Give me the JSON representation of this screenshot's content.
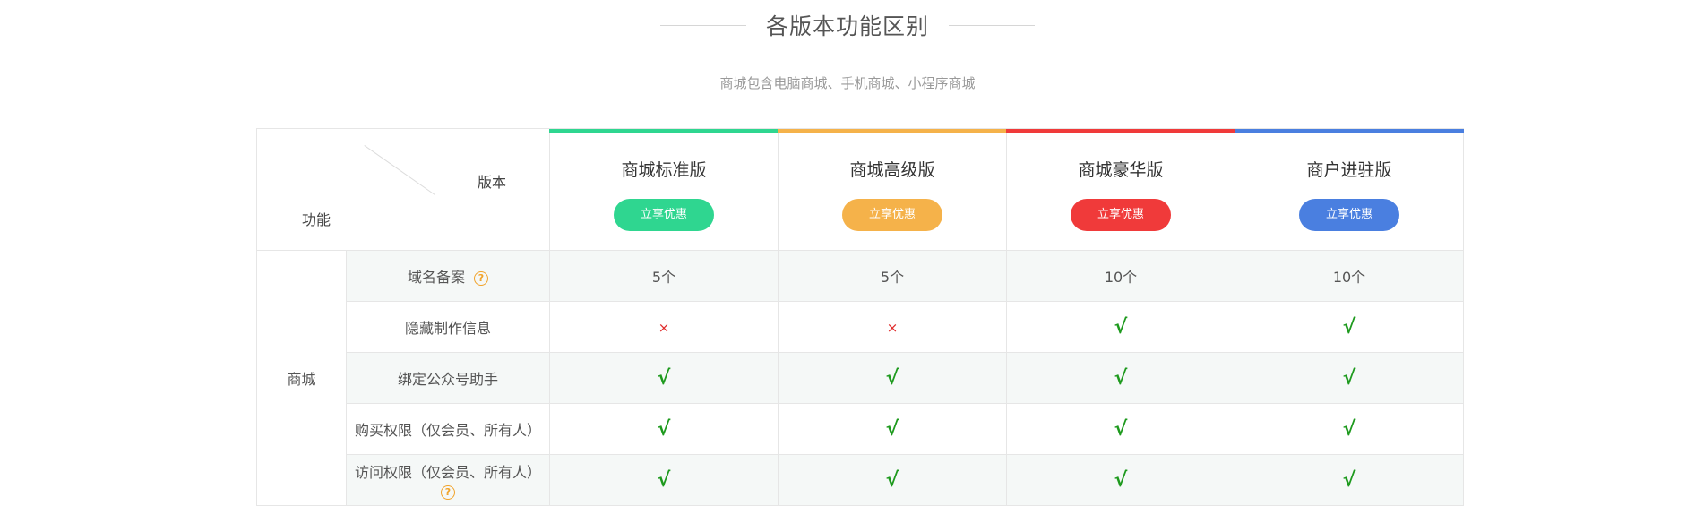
{
  "heading": {
    "title": "各版本功能区别",
    "subtitle": "商城包含电脑商城、手机商城、小程序商城"
  },
  "corner": {
    "version_label": "版本",
    "feature_label": "功能"
  },
  "colors": {
    "standard": "#2fd690",
    "advanced": "#f5b24a",
    "luxury": "#f03a3a",
    "merchant": "#4a7fe0"
  },
  "versions": [
    {
      "name": "商城标准版",
      "button": "立享优惠"
    },
    {
      "name": "商城高级版",
      "button": "立享优惠"
    },
    {
      "name": "商城豪华版",
      "button": "立享优惠"
    },
    {
      "name": "商户进驻版",
      "button": "立享优惠"
    }
  ],
  "category": "商城",
  "rows": [
    {
      "feature": "域名备案",
      "has_help": true,
      "values": [
        "5个",
        "5个",
        "10个",
        "10个"
      ]
    },
    {
      "feature": "隐藏制作信息",
      "has_help": false,
      "values": [
        "cross",
        "cross",
        "check",
        "check"
      ]
    },
    {
      "feature": "绑定公众号助手",
      "has_help": false,
      "values": [
        "check",
        "check",
        "check",
        "check"
      ]
    },
    {
      "feature": "购买权限（仅会员、所有人）",
      "has_help": false,
      "values": [
        "check",
        "check",
        "check",
        "check"
      ]
    },
    {
      "feature": "访问权限（仅会员、所有人）",
      "has_help": true,
      "values": [
        "check",
        "check",
        "check",
        "check"
      ]
    }
  ],
  "symbols": {
    "check": "√",
    "cross": "×",
    "help": "?"
  },
  "icons": {
    "check": "check-icon",
    "cross": "cross-icon",
    "help": "help-circle-icon"
  }
}
